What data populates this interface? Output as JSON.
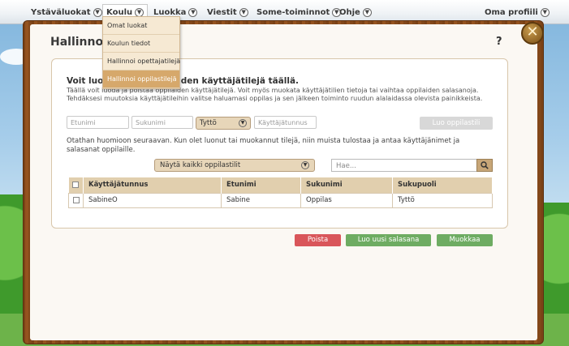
{
  "nav": {
    "items": [
      {
        "label": "Ystäväluokat"
      },
      {
        "label": "Koulu"
      },
      {
        "label": "Luokka"
      },
      {
        "label": "Viestit"
      },
      {
        "label": "Some-toiminnot"
      },
      {
        "label": "Ohje"
      },
      {
        "label": "Oma profiili"
      }
    ],
    "chevron": "⌄"
  },
  "dropdown": {
    "items": [
      "Omat luokat",
      "Koulun tiedot",
      "Hallinnoi opettajatilejä",
      "Hallinnoi oppilastilejä"
    ]
  },
  "window": {
    "title": "Hallinnoi o",
    "help": "?",
    "close": "✕"
  },
  "form": {
    "headline": "Voit luod",
    "headline_end": "ilaiden käyttäjätilejä täällä.",
    "desc_line1_start": "Täällä voit luoda ja poistaa o",
    "desc_line1_end": "ppilaiden käyttäjätilejä. Voit myös muokata käyttäjätilien tietoja tai vaihtaa oppilaiden salasanoja.",
    "desc_line2": "Tehdäksesi muutoksia käyttäjätileihin valitse haluamasi oppilas ja sen jälkeen toiminto ruudun alalaidassa olevista painikkeista.",
    "firstname_placeholder": "Etunimi",
    "lastname_placeholder": "Sukunimi",
    "gender_value": "Tyttö",
    "username_placeholder": "Käyttäjätunnus",
    "create_button": "Luo oppilastili",
    "note": "Otathan huomioon seuraavan. Kun olet luonut tai muokannut tilejä, niin muista tulostaa ja antaa käyttäjänimet ja salasanat oppilaille.",
    "filter_value": "Näytä kaikki oppilastilit",
    "search_placeholder": "Hae..."
  },
  "table": {
    "headers": [
      "Käyttäjätunnus",
      "Etunimi",
      "Sukunimi",
      "Sukupuoli"
    ],
    "rows": [
      [
        "SabineO",
        "Sabine",
        "Oppilas",
        "Tyttö"
      ]
    ]
  },
  "actions": {
    "delete": "Poista",
    "new_password": "Luo uusi salasana",
    "edit": "Muokkaa"
  },
  "colors": {
    "accent": "#d6a86b",
    "delete": "#d9565a",
    "positive": "#6eac62"
  }
}
